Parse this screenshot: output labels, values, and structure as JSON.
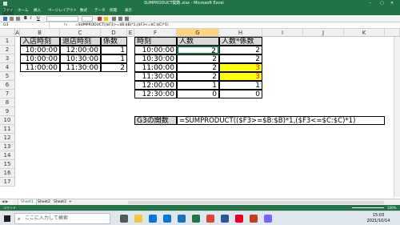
{
  "window": {
    "title": "SUMPRODUCT関数.xlsx - Microsoft Excel",
    "ribbon_tabs": [
      "ファイル",
      "ホーム",
      "挿入",
      "ページレイアウト",
      "数式",
      "データ",
      "校閲",
      "表示"
    ]
  },
  "formula_bar": {
    "name_box": "G3",
    "formula": "=SUMPRODUCT(($F3>=$B:$B)*1,($F3<=$C:$C)*1)"
  },
  "columns": [
    "A",
    "B",
    "C",
    "D",
    "E",
    "F",
    "G",
    "H",
    "I",
    "J",
    "K"
  ],
  "rows": [
    "1",
    "2",
    "3",
    "4",
    "5",
    "6",
    "7",
    "8",
    "9",
    "10",
    "11",
    "12",
    "13",
    "14",
    "15",
    "16",
    "17"
  ],
  "left_table": {
    "headers": [
      "入店時刻",
      "退店時刻",
      "係数"
    ],
    "rows": [
      [
        "10:00:00",
        "12:00:00",
        "1"
      ],
      [
        "10:00:00",
        "10:30:00",
        "1"
      ],
      [
        "11:00:00",
        "11:30:00",
        "2"
      ]
    ]
  },
  "right_table": {
    "headers": [
      "時刻",
      "人数",
      "人数*係数"
    ],
    "rows": [
      [
        "10:00:00",
        "2",
        "2"
      ],
      [
        "10:30:00",
        "2",
        "2"
      ],
      [
        "11:00:00",
        "2",
        "3"
      ],
      [
        "11:30:00",
        "2",
        "3"
      ],
      [
        "12:00:00",
        "1",
        "1"
      ],
      [
        "12:30:00",
        "0",
        "0"
      ]
    ]
  },
  "formula_note": {
    "label": "G3の関数",
    "text": "=SUMPRODUCT(($F3>=$B:$B)*1,($F3<=$C:$C)*1)"
  },
  "sheets": [
    "Sheet1",
    "Sheet2",
    "Sheet3"
  ],
  "status": {
    "left": "コマンド",
    "zoom": "100%"
  },
  "taskbar": {
    "search_placeholder": "ここに入力して検索",
    "time": "15:03",
    "date": "2021/10/14"
  },
  "colors": {
    "excel_green": "#217346",
    "highlight_yellow": "#ffff00",
    "header_gray": "#d9d9d9",
    "selected_col": "#ffd580"
  }
}
